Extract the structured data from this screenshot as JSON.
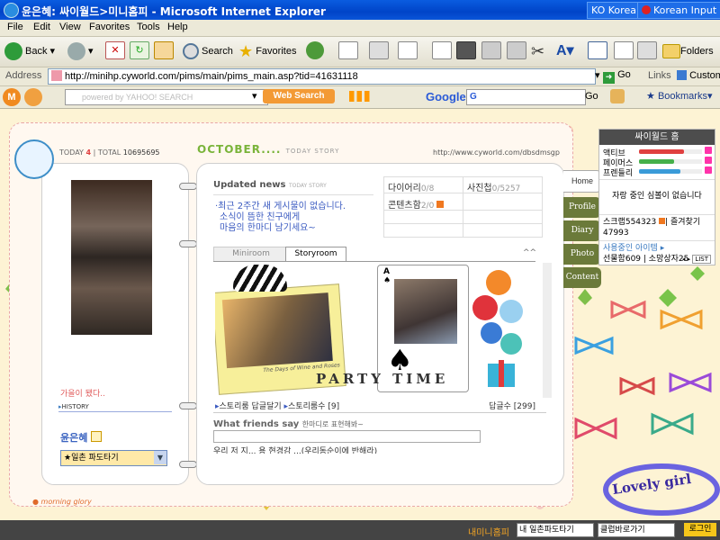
{
  "window": {
    "title": "윤은혜: 싸이월드>미니홈피 - Microsoft Internet Explorer",
    "lang_indicator": "KO Korean",
    "ime": "Korean Input Syst"
  },
  "menu": {
    "items": [
      "File",
      "Edit",
      "View",
      "Favorites",
      "Tools",
      "Help"
    ]
  },
  "toolbar": {
    "back": "Back",
    "search": "Search",
    "favorites": "Favorites",
    "folders": "Folders"
  },
  "address": {
    "label": "Address",
    "url": "http://minihp.cyworld.com/pims/main/pims_main.asp?tid=41631118",
    "go": "Go",
    "links": "Links",
    "custom": "Customiz"
  },
  "searchbar": {
    "yahoo_placeholder": "powered by YAHOO! SEARCH",
    "web_search": "Web Search",
    "google": "Google",
    "g_field": "G",
    "go": "Go",
    "bookmarks": "Bookmarks"
  },
  "diary": {
    "today_label": "TODAY",
    "today_value": "4",
    "total_label": "TOTAL",
    "total_value": "10695695",
    "month": "OCTOBER....",
    "today_story": "TODAY STORY",
    "url": "http://www.cyworld.com/dbsdmsgp",
    "left_caption": "가을이 됐다..",
    "history": "HISTORY",
    "owner": "윤은혜",
    "dropdown": "★일촌 파도타기",
    "updated_news": "Updated news",
    "today_story_small": "TODAY STORY",
    "news_lines": [
      "·최근 2주간 새 게시물이 없습니다.",
      "소식이 뜸한 친구에게",
      "마음의 한마디 남기세요~"
    ],
    "stats": {
      "diary": "다이어리",
      "diary_count": "0/8",
      "photo": "사진첩",
      "photo_count": "0/5257",
      "content": "콘텐츠함",
      "content_count": "2/0"
    },
    "tabs_room": {
      "miniroom": "Miniroom",
      "storyroom": "Storyroom"
    },
    "storyroom_title": "PARTY TIME",
    "photo_caption": "The Days of Wine and Roses",
    "story_links": {
      "reply": "스토리룸 답글달기",
      "count_label": "스토리룸수",
      "count": "[9]",
      "reply_count_label": "답글수",
      "reply_count": "[299]"
    },
    "what_friends": "What friends say",
    "what_friends_sub": "한마디로 표현해봐~",
    "friend_line": "우리 저 지... 용 현경감 ...(우리동순이에 반해라)",
    "nav_tabs": [
      "Home",
      "Profile",
      "Diary",
      "Photo",
      "Content"
    ],
    "bottom_left": "morning glory"
  },
  "sidebar": {
    "header": "싸이월드 홈",
    "meters": [
      {
        "label": "액티브",
        "value": 0.72,
        "color": "#e04040"
      },
      {
        "label": "페이머스",
        "value": 0.55,
        "color": "#45b04a"
      },
      {
        "label": "프렌들리",
        "value": 0.65,
        "color": "#3a9bd8"
      }
    ],
    "status": "자랑 중인 심볼이 없습니다",
    "scrap_label": "스크랩",
    "scrap_value": "554323",
    "fav_label": "즐겨찾기",
    "fav_value": "47993",
    "item_label": "사용중인 아이템",
    "gift_label": "선물함",
    "gift_value": "609",
    "pocket_label": "소망상자",
    "pocket_value": "25",
    "list": "LIST"
  },
  "sticker": "Lovely girl",
  "bottom": {
    "myhome": "내미니홈피",
    "wave": "내 일촌파도타기",
    "club": "클럽바로가기",
    "login": "로그인"
  }
}
